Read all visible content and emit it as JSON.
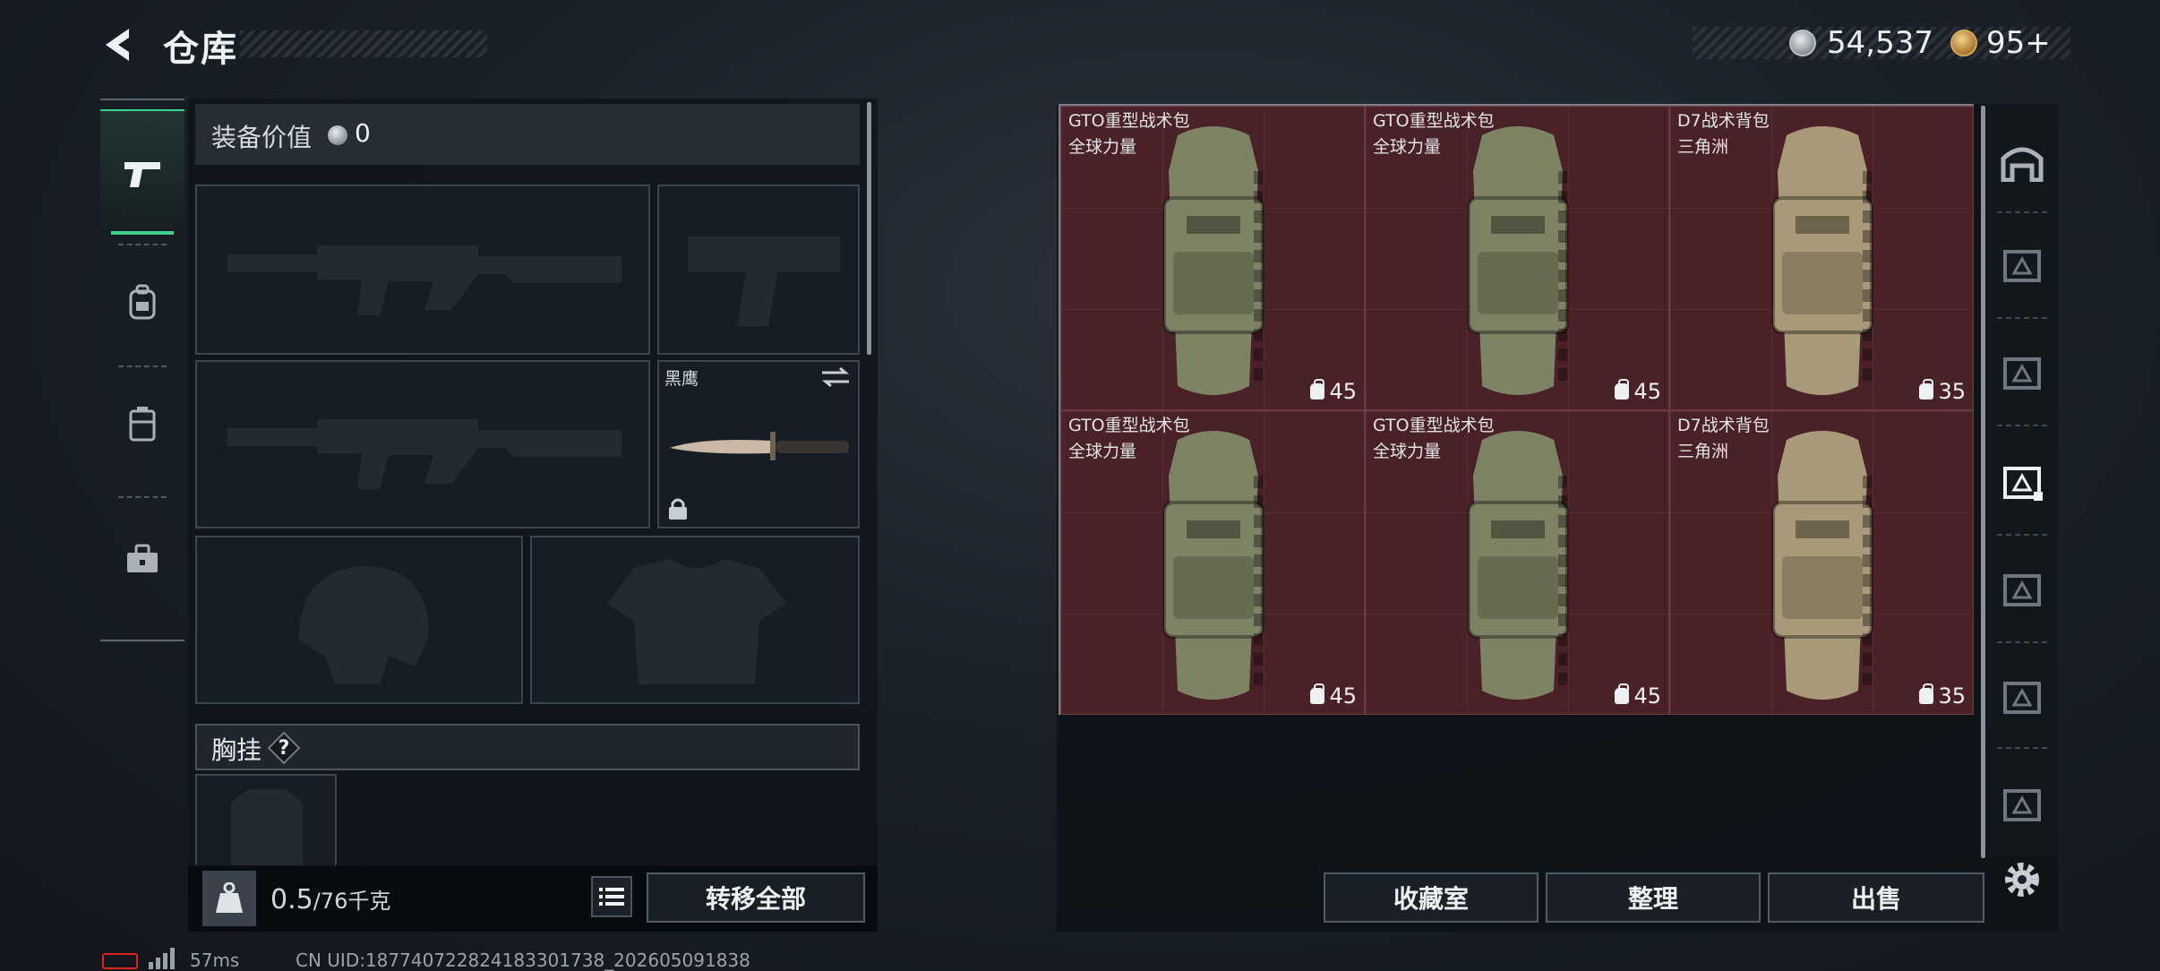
{
  "header": {
    "title": "仓库",
    "currency": {
      "silver": "54,537",
      "gold": "95+"
    }
  },
  "equipment": {
    "value_label": "装备价值",
    "value_amount": "0",
    "knife_name": "黑鹰",
    "chest_label": "胸挂",
    "chest_help": "?",
    "weight_current": "0.5",
    "weight_sep_max": "/76",
    "weight_unit": "千克",
    "transfer_all": "转移全部"
  },
  "storage": {
    "items": [
      {
        "name": "GTO重型战术包",
        "brand": "全球力量",
        "capacity": "45",
        "color": "#7c8464"
      },
      {
        "name": "GTO重型战术包",
        "brand": "全球力量",
        "capacity": "45",
        "color": "#7c8464"
      },
      {
        "name": "D7战术背包",
        "brand": "三角洲",
        "capacity": "35",
        "color": "#a89a78"
      },
      {
        "name": "GTO重型战术包",
        "brand": "全球力量",
        "capacity": "45",
        "color": "#7c8464"
      },
      {
        "name": "GTO重型战术包",
        "brand": "全球力量",
        "capacity": "45",
        "color": "#7c8464"
      },
      {
        "name": "D7战术背包",
        "brand": "三角洲",
        "capacity": "35",
        "color": "#a89a78"
      }
    ],
    "actions": {
      "collection": "收藏室",
      "sort": "整理",
      "sell": "出售"
    }
  },
  "status": {
    "ping": "57ms",
    "uid": "CN UID:187740722824183301738_202605091838"
  },
  "colors": {
    "accent": "#3bd18a",
    "cell_bg": "#4b2128",
    "battery": "#dd2222"
  }
}
